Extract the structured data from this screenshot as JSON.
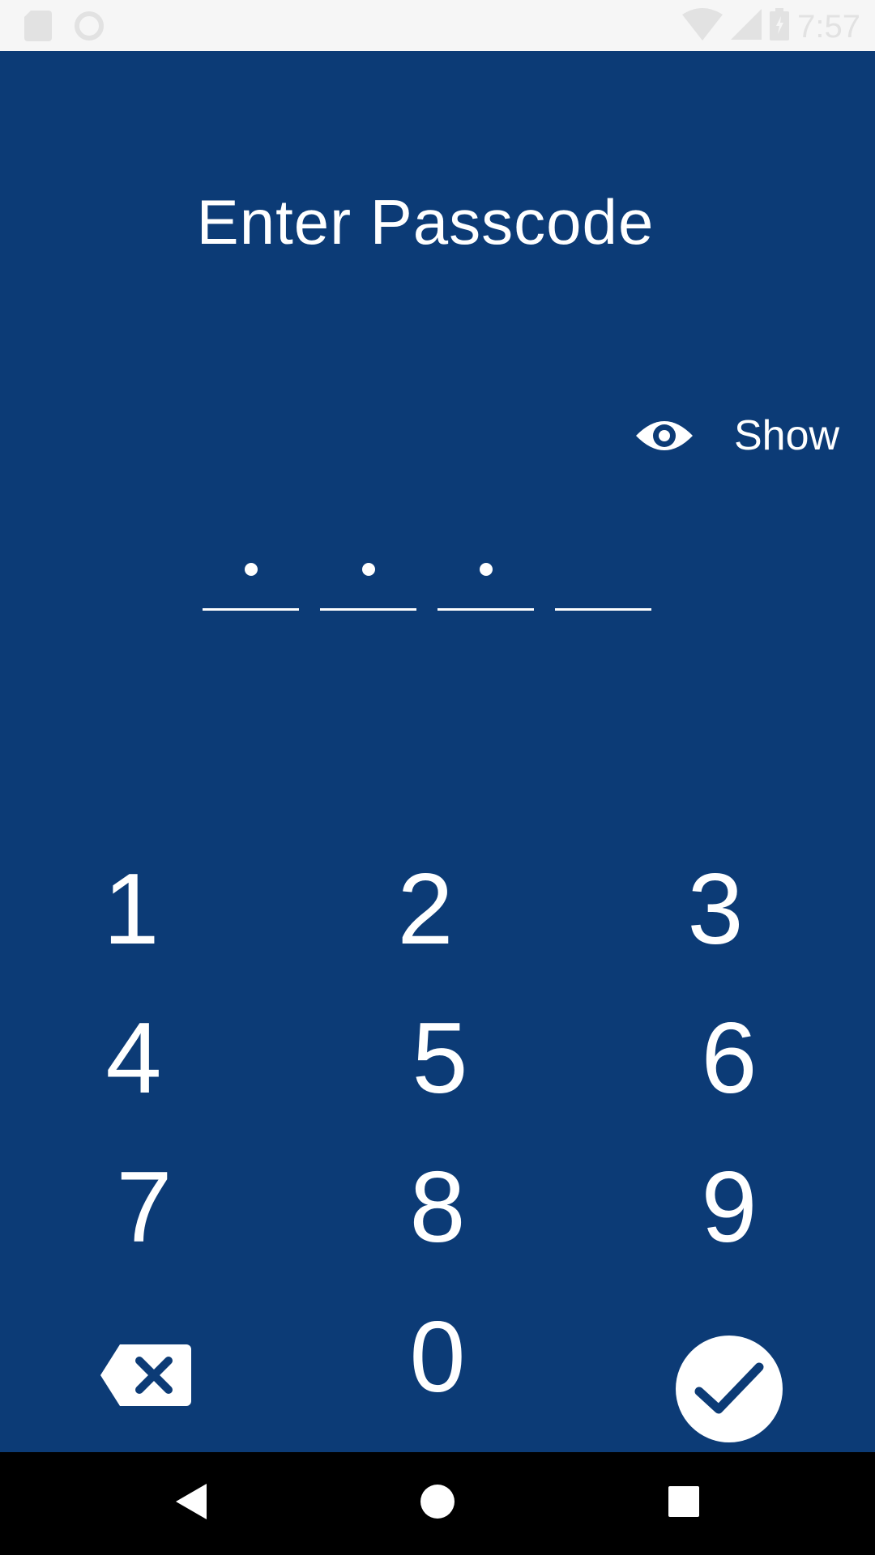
{
  "status_bar": {
    "time": "7:57",
    "icons_left": [
      "sd-card-icon",
      "circle-sync-icon"
    ],
    "icons_right": [
      "wifi-icon",
      "signal-icon",
      "battery-icon"
    ]
  },
  "title": "Enter Passcode",
  "show_toggle": {
    "label": "Show",
    "icon": "eye-icon"
  },
  "passcode": {
    "slots": 4,
    "filled": 3
  },
  "keypad": {
    "keys": [
      "1",
      "2",
      "3",
      "4",
      "5",
      "6",
      "7",
      "8",
      "9",
      "0"
    ],
    "backspace_icon": "backspace-icon",
    "confirm_icon": "checkmark-icon"
  },
  "nav_bar": {
    "buttons": [
      "back-icon",
      "home-icon",
      "recents-icon"
    ]
  },
  "colors": {
    "background": "#0c3b76",
    "foreground": "#ffffff",
    "status_bar": "#f6f6f6",
    "nav_bar": "#000000"
  }
}
